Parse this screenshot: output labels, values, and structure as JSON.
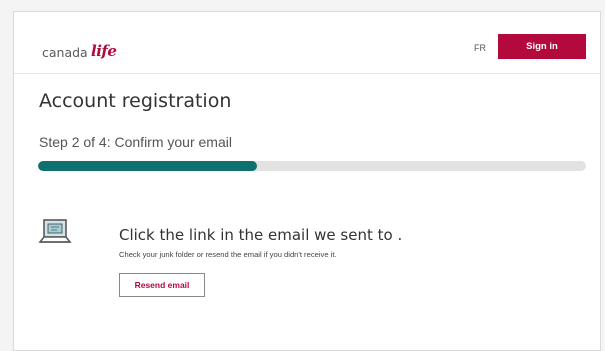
{
  "header": {
    "logo_text": "canada",
    "logo_mark": "life",
    "lang_link": "FR",
    "signin_label": "Sign in"
  },
  "main": {
    "title": "Account registration",
    "step_label": "Step 2 of 4: Confirm your email",
    "progress": 0.4,
    "heading": "Click the link in the email we sent to .",
    "hint": "Check your junk folder or resend the email if you didn't receive it.",
    "resend_label": "Resend email"
  },
  "icons": {
    "email_sent": "laptop-icon"
  },
  "colors": {
    "brand": "#b3093c",
    "progress": "#0f716f",
    "track": "#e2e2e2"
  }
}
